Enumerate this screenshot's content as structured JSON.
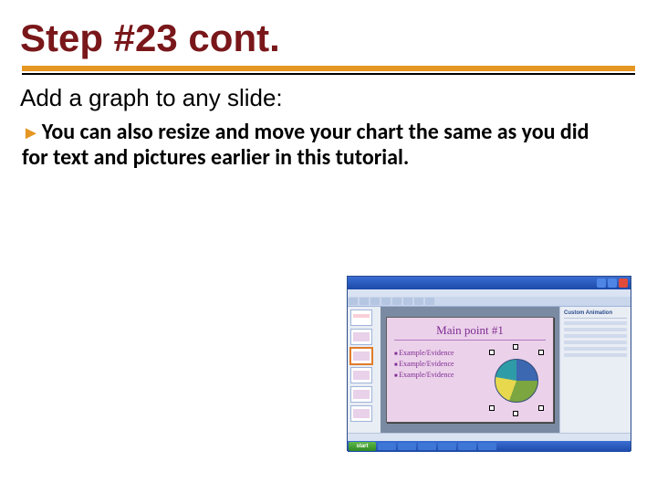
{
  "title": "Step #23 cont.",
  "subtitle": "Add a graph to any slide:",
  "bullet": "You can also resize and move your chart the same as you did for text and pictures earlier in this tutorial.",
  "screenshot": {
    "slide_title": "Main point #1",
    "bullets": [
      "Example/Evidence",
      "Example/Evidence",
      "Example/Evidence"
    ],
    "taskpane": "Custom Animation",
    "start": "start"
  }
}
